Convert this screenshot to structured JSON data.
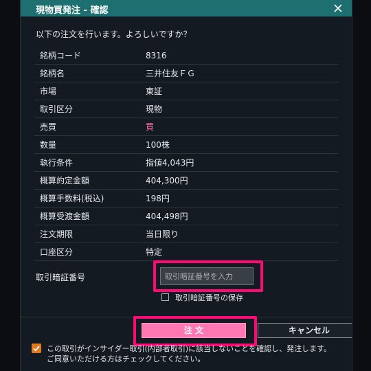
{
  "dialog": {
    "title": "現物買発注 - 確認",
    "prompt": "以下の注文を行います。よろしいですか？"
  },
  "order_details": [
    {
      "label": "銘柄コード",
      "value": "8316"
    },
    {
      "label": "銘柄名",
      "value": "三井住友ＦＧ"
    },
    {
      "label": "市場",
      "value": "東証"
    },
    {
      "label": "取引区分",
      "value": "現物"
    },
    {
      "label": "売買",
      "value": "買"
    },
    {
      "label": "数量",
      "value": "100株"
    },
    {
      "label": "執行条件",
      "value": "指値4,043円"
    },
    {
      "label": "概算約定金額",
      "value": "404,300円"
    },
    {
      "label": "概算手数料(税込)",
      "value": "198円"
    },
    {
      "label": "概算受渡金額",
      "value": "404,498円"
    },
    {
      "label": "注文期限",
      "value": "当日限り"
    },
    {
      "label": "口座区分",
      "value": "特定"
    }
  ],
  "pin": {
    "label": "取引暗証番号",
    "placeholder": "取引暗証番号を入力",
    "value": "",
    "save_label": "取引暗証番号の保存",
    "save_checked": false
  },
  "buttons": {
    "order": "注 文",
    "cancel": "キャンセル"
  },
  "agreement": {
    "checked": true,
    "line1": "この取引がインサイダー取引(内部者取引)に該当しないことを確認し、発注します。",
    "line2": "ご同意いただける方はチェックしてください。"
  },
  "colors": {
    "titlebar": "#1e6f6f",
    "dialog_bg": "#131a21",
    "sell_text": "#ff6fae",
    "order_button": "#ff78b3",
    "highlight": "#ff0a74",
    "agree_checkbox": "#e07a1e"
  },
  "icons": {
    "close": "close-icon",
    "check": "checkmark-icon"
  }
}
